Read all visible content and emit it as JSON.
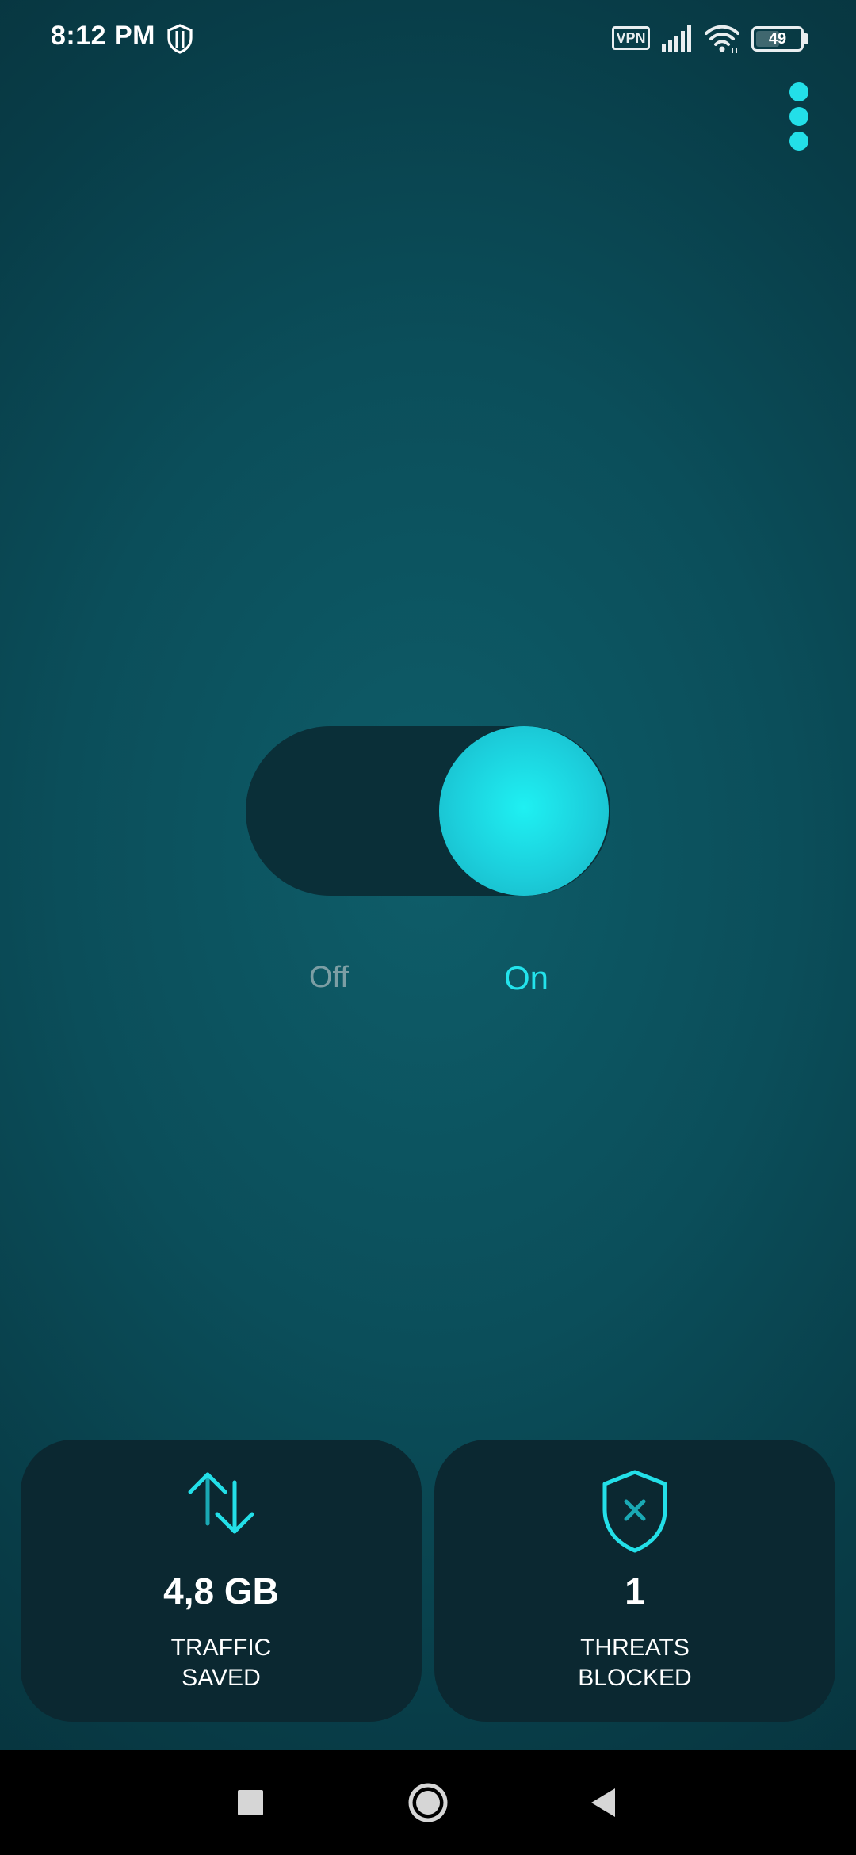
{
  "status_bar": {
    "time": "8:12 PM",
    "vpn_badge": "VPN",
    "battery_level": "49",
    "icons": [
      "vpn-shield-icon",
      "signal-icon",
      "wifi-icon",
      "battery-icon"
    ]
  },
  "menu": {
    "icon": "more-vertical-icon"
  },
  "toggle": {
    "state": "on",
    "off_label": "Off",
    "on_label": "On"
  },
  "stats": {
    "traffic": {
      "icon": "up-down-arrows-icon",
      "value": "4,8 GB",
      "label_line1": "TRAFFIC",
      "label_line2": "SAVED"
    },
    "threats": {
      "icon": "shield-x-icon",
      "value": "1",
      "label_line1": "THREATS",
      "label_line2": "BLOCKED"
    }
  },
  "nav_bar": {
    "icons": [
      "recents-square-icon",
      "home-circle-icon",
      "back-triangle-icon"
    ]
  },
  "colors": {
    "accent": "#23dfe8",
    "card_background": "#0b2831",
    "background": "#0b4e5a"
  }
}
